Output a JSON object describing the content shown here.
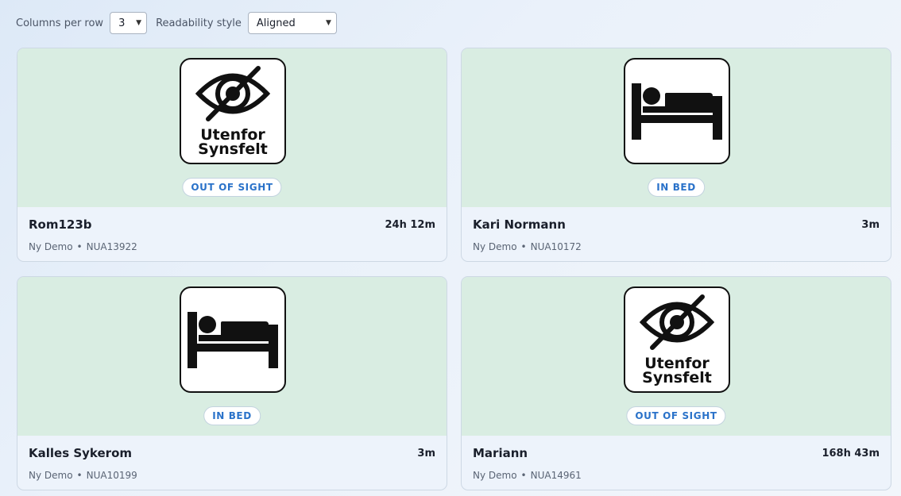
{
  "toolbar": {
    "columns_label": "Columns per row",
    "columns_value": "3",
    "style_label": "Readability style",
    "style_value": "Aligned"
  },
  "cards": [
    {
      "name": "Rom123b",
      "duration": "24h 12m",
      "org": "Ny Demo",
      "device_id": "NUA13922",
      "status": "OUT OF SIGHT",
      "icon": "eye-slash-icon",
      "icon_text": [
        "Utenfor",
        "Synsfelt"
      ]
    },
    {
      "name": "Kari Normann",
      "duration": "3m",
      "org": "Ny Demo",
      "device_id": "NUA10172",
      "status": "IN BED",
      "icon": "bed-icon"
    },
    {
      "name": "Kalles Sykerom",
      "duration": "3m",
      "org": "Ny Demo",
      "device_id": "NUA10199",
      "status": "IN BED",
      "icon": "bed-icon"
    },
    {
      "name": "Mariann",
      "duration": "168h 43m",
      "org": "Ny Demo",
      "device_id": "NUA14961",
      "status": "OUT OF SIGHT",
      "icon": "eye-slash-icon",
      "icon_text": [
        "Utenfor",
        "Synsfelt"
      ]
    }
  ],
  "colors": {
    "card_top": "#d9ede2",
    "badge_text": "#2a72c9"
  }
}
